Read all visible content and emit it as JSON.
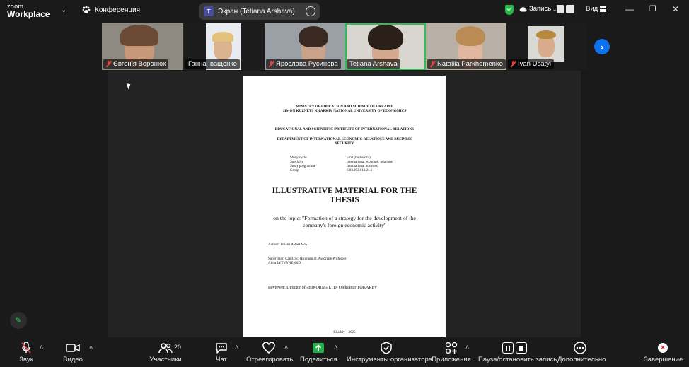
{
  "app": {
    "brand_small": "zoom",
    "brand_large": "Workplace"
  },
  "meeting": {
    "title": "Конференция"
  },
  "share": {
    "label": "Экран (Tetiana Arshava)",
    "badge": "T"
  },
  "top_right": {
    "recording": "Запись...",
    "view": "Вид"
  },
  "participants": [
    {
      "name": "Євгенія Воронюк",
      "muted": true
    },
    {
      "name": "Ганна Іващенко",
      "muted": false
    },
    {
      "name": "Ярослава Русинова",
      "muted": true
    },
    {
      "name": "Tetiana Arshava",
      "muted": false,
      "active": true
    },
    {
      "name": "Nataliia Parkhomenko",
      "muted": true
    },
    {
      "name": "Ivan Usatyi",
      "muted": true
    }
  ],
  "document": {
    "ministry": "MINISTRY OF EDUCATION AND SCIENCE OF UKRAINE",
    "university": "SIMON KUZNETS KHARKIV NATIONAL UNIVERSITY OF ECONOMICS",
    "institute": "EDUCATIONAL AND SCIENTIFIC INSTITUTE OF INTERNATIONAL RELATIONS",
    "department_1": "DEPARTMENT OF INTERNATIONAL ECONOMIC RELATIONS AND BUSINESS",
    "department_2": "SECURITY",
    "study_labels": [
      "Study cycle",
      "Specialty",
      "Study programme",
      "Group"
    ],
    "study_values": [
      "First (bachelor's)",
      "International economic relations",
      "International business",
      "6.03.292.010.21.1"
    ],
    "title": "ILLUSTRATIVE MATERIAL FOR THE THESIS",
    "topic": "on the topic: \"Formation of a strategy for the development of the company's foreign economic activity\"",
    "author": "Author: Tetiana ARSHAVA",
    "supervisor_1": "Supervisor: Cand. Sc. (Economic), Associate Professor",
    "supervisor_2": "Alina LYTVYNENKO",
    "reviewer": "Reviewer: Director of «BIKORM» LTD, Oleksandr TOKAREV",
    "footer": "Kharkiv – 2025"
  },
  "toolbar": {
    "audio": "Звук",
    "video": "Видео",
    "participants": "Участники",
    "participants_count": "20",
    "chat": "Чат",
    "react": "Отреагировать",
    "share": "Поделиться",
    "host_tools": "Инструменты организатора",
    "apps": "Приложения",
    "pause_record": "Пауза/остановить запись",
    "more": "Дополнительно",
    "end": "Завершение"
  },
  "colors": {
    "active_green": "#2fbf57",
    "accent_blue": "#0e72ed",
    "muted_red": "#e04848"
  }
}
